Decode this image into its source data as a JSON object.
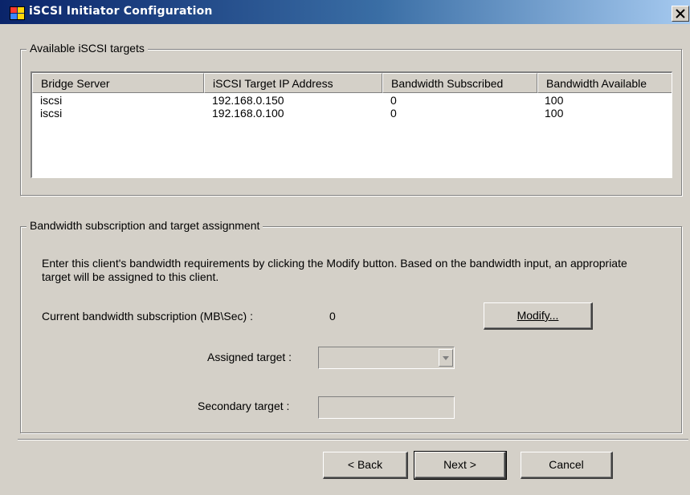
{
  "window": {
    "title": "iSCSI Initiator Configuration",
    "icon": "app-window-icon",
    "close_icon": "close-icon"
  },
  "targets_group": {
    "legend": "Available iSCSI targets",
    "columns": [
      "Bridge Server",
      "iSCSI Target IP Address",
      "Bandwidth Subscribed",
      "Bandwidth Available"
    ],
    "rows": [
      [
        "iscsi",
        "192.168.0.150",
        "0",
        "100"
      ],
      [
        "iscsi",
        "192.168.0.100",
        "0",
        "100"
      ]
    ]
  },
  "bandwidth_group": {
    "legend": "Bandwidth subscription and target assignment",
    "instructions": "Enter this client's bandwidth requirements by clicking the Modify button. Based on the bandwidth input, an appropriate target will be assigned to this client.",
    "current_label": "Current bandwidth subscription (MB\\Sec) :",
    "current_value": "0",
    "modify_button": "Modify...",
    "assigned_label": "Assigned target :",
    "assigned_value": "",
    "secondary_label": "Secondary target :",
    "secondary_value": ""
  },
  "footer": {
    "back_button": "< Back",
    "next_button": "Next >",
    "cancel_button": "Cancel"
  },
  "colors": {
    "title_start": "#0a246a",
    "title_end": "#a6caf0",
    "dialog_bg": "#d4d0c8"
  }
}
